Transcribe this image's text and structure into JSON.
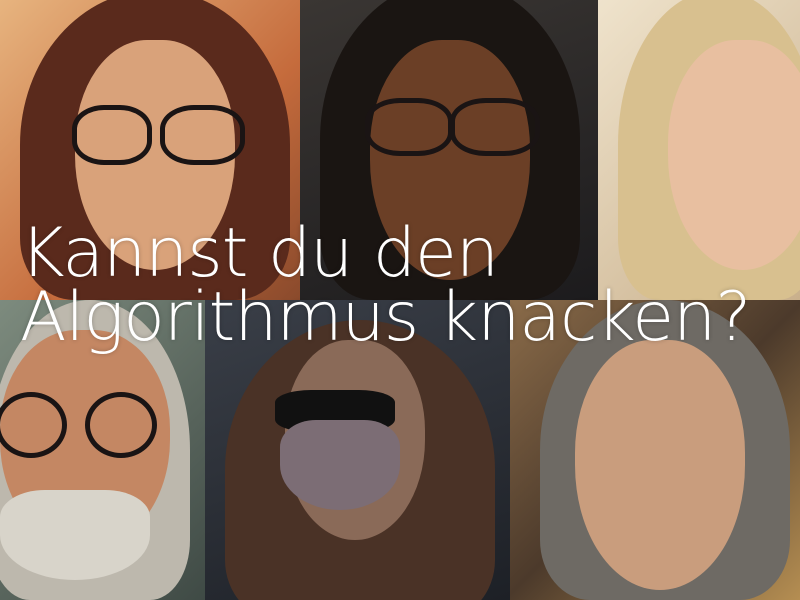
{
  "headline": {
    "line1": "Kannst du den",
    "line2": "Algorithmus knacken?",
    "color": "#ffffff"
  },
  "portraits": [
    {
      "subject": "woman-with-glasses-brown-hair",
      "background": "#c98a55"
    },
    {
      "subject": "woman-with-glasses-curly-hair",
      "background": "#2c2a2b"
    },
    {
      "subject": "blonde-woman",
      "background": "#e3d2b6"
    },
    {
      "subject": "older-man-with-glasses-beard",
      "background": "#5b6b62"
    },
    {
      "subject": "woman-with-face-mask",
      "background": "#2a2e36"
    },
    {
      "subject": "older-woman-gray-hair",
      "background": "#6d5a45"
    }
  ]
}
